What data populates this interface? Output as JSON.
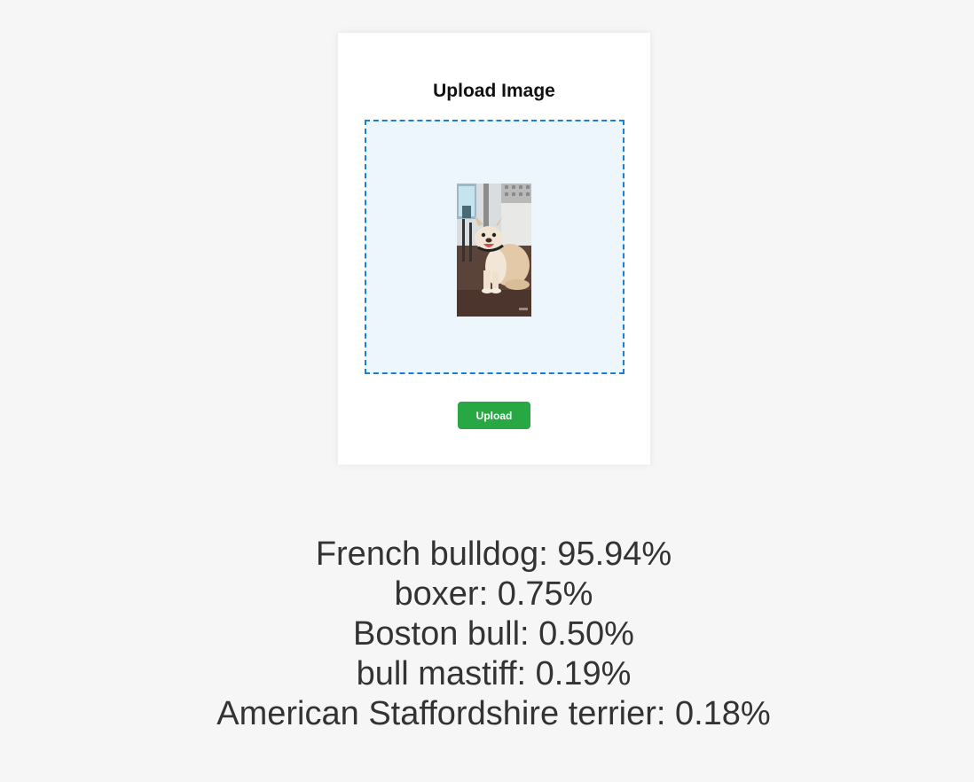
{
  "card": {
    "title": "Upload Image",
    "upload_label": "Upload"
  },
  "preview": {
    "icon": "uploaded-dog-photo"
  },
  "results": [
    "French bulldog: 95.94%",
    "boxer: 0.75%",
    "Boston bull: 0.50%",
    "bull mastiff: 0.19%",
    "American Staffordshire terrier: 0.18%"
  ],
  "colors": {
    "accent": "#1a7fd4",
    "button": "#28a745",
    "dropzone_bg": "#eef6fd",
    "page_bg": "#f6f6f6"
  }
}
